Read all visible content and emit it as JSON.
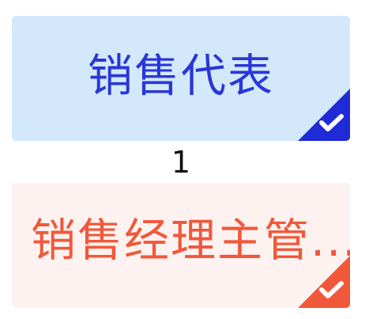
{
  "options": [
    {
      "label": "销售代表",
      "selected": true,
      "colors": {
        "background": "#d3e9fb",
        "text": "#2a37d8",
        "badge": "#1f2bd6"
      },
      "badge_icon": "checkmark-icon"
    },
    {
      "label": "销售经理主管...",
      "selected": true,
      "colors": {
        "background": "#fdf2f0",
        "text": "#f0583a",
        "badge": "#f0583a"
      },
      "badge_icon": "checkmark-icon"
    }
  ],
  "counter": {
    "value": "1"
  }
}
